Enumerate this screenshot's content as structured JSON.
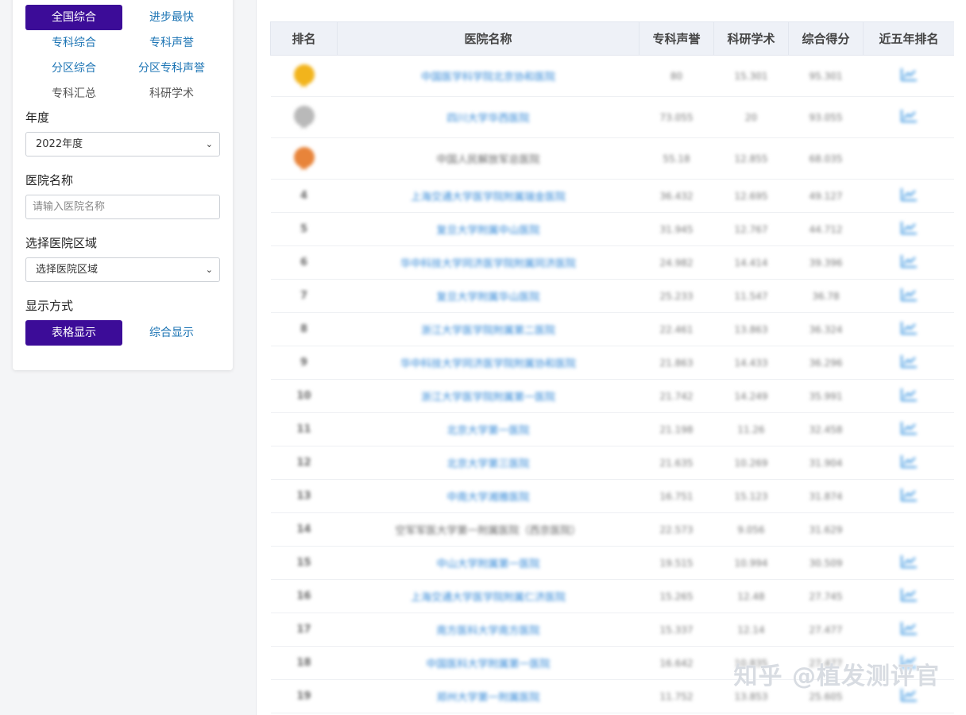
{
  "filters": {
    "tabs": [
      {
        "label": "全国综合",
        "active": true
      },
      {
        "label": "进步最快",
        "active": false
      },
      {
        "label": "专科综合",
        "active": false
      },
      {
        "label": "专科声誉",
        "active": false
      },
      {
        "label": "分区综合",
        "active": false
      },
      {
        "label": "分区专科声誉",
        "active": false
      },
      {
        "label": "专科汇总",
        "active": false
      },
      {
        "label": "科研学术",
        "active": false
      }
    ],
    "year_label": "年度",
    "year_value": "2022年度",
    "hospital_label": "医院名称",
    "hospital_placeholder": "请输入医院名称",
    "region_label": "选择医院区域",
    "region_value": "选择医院区域",
    "display_label": "显示方式",
    "display_table": "表格显示",
    "display_combined": "综合显示"
  },
  "table": {
    "headers": [
      "排名",
      "医院名称",
      "专科声誉",
      "科研学术",
      "综合得分",
      "近五年排名"
    ],
    "rows": [
      {
        "rank": "",
        "medal": "gold",
        "name": "中国医学科学院北京协和医院",
        "rep": "80",
        "sci": "15.301",
        "score": "95.301",
        "trend": true
      },
      {
        "rank": "",
        "medal": "silver",
        "name": "四川大学华西医院",
        "rep": "73.055",
        "sci": "20",
        "score": "93.055",
        "trend": true
      },
      {
        "rank": "",
        "medal": "bronze",
        "name": "中国人民解放军总医院",
        "rep": "55.18",
        "sci": "12.855",
        "score": "68.035",
        "trend": false
      },
      {
        "rank": "4",
        "name": "上海交通大学医学院附属瑞金医院",
        "rep": "36.432",
        "sci": "12.695",
        "score": "49.127",
        "trend": true
      },
      {
        "rank": "5",
        "name": "复旦大学附属中山医院",
        "rep": "31.945",
        "sci": "12.767",
        "score": "44.712",
        "trend": true
      },
      {
        "rank": "6",
        "name": "华中科技大学同济医学院附属同济医院",
        "rep": "24.982",
        "sci": "14.414",
        "score": "39.396",
        "trend": true
      },
      {
        "rank": "7",
        "name": "复旦大学附属华山医院",
        "rep": "25.233",
        "sci": "11.547",
        "score": "36.78",
        "trend": true
      },
      {
        "rank": "8",
        "name": "浙江大学医学院附属第二医院",
        "rep": "22.461",
        "sci": "13.863",
        "score": "36.324",
        "trend": true
      },
      {
        "rank": "9",
        "name": "华中科技大学同济医学院附属协和医院",
        "rep": "21.863",
        "sci": "14.433",
        "score": "36.296",
        "trend": true
      },
      {
        "rank": "10",
        "name": "浙江大学医学院附属第一医院",
        "rep": "21.742",
        "sci": "14.249",
        "score": "35.991",
        "trend": true
      },
      {
        "rank": "11",
        "name": "北京大学第一医院",
        "rep": "21.198",
        "sci": "11.26",
        "score": "32.458",
        "trend": true
      },
      {
        "rank": "12",
        "name": "北京大学第三医院",
        "rep": "21.635",
        "sci": "10.269",
        "score": "31.904",
        "trend": true
      },
      {
        "rank": "13",
        "name": "中南大学湘雅医院",
        "rep": "16.751",
        "sci": "15.123",
        "score": "31.874",
        "trend": true
      },
      {
        "rank": "14",
        "name": "空军军医大学第一附属医院（西京医院）",
        "rep": "22.573",
        "sci": "9.056",
        "score": "31.629",
        "trend": false
      },
      {
        "rank": "15",
        "name": "中山大学附属第一医院",
        "rep": "19.515",
        "sci": "10.994",
        "score": "30.509",
        "trend": true
      },
      {
        "rank": "16",
        "name": "上海交通大学医学院附属仁济医院",
        "rep": "15.265",
        "sci": "12.48",
        "score": "27.745",
        "trend": true
      },
      {
        "rank": "17",
        "name": "南方医科大学南方医院",
        "rep": "15.337",
        "sci": "12.14",
        "score": "27.477",
        "trend": true
      },
      {
        "rank": "18",
        "name": "中国医科大学附属第一医院",
        "rep": "16.642",
        "sci": "10.835",
        "score": "27.477",
        "trend": true
      },
      {
        "rank": "19",
        "name": "郑州大学第一附属医院",
        "rep": "11.752",
        "sci": "13.853",
        "score": "25.605",
        "trend": true
      }
    ]
  },
  "watermark": "知乎 @植发测评官",
  "colors": {
    "accent": "#3c0c98",
    "link": "#2f86d6"
  }
}
